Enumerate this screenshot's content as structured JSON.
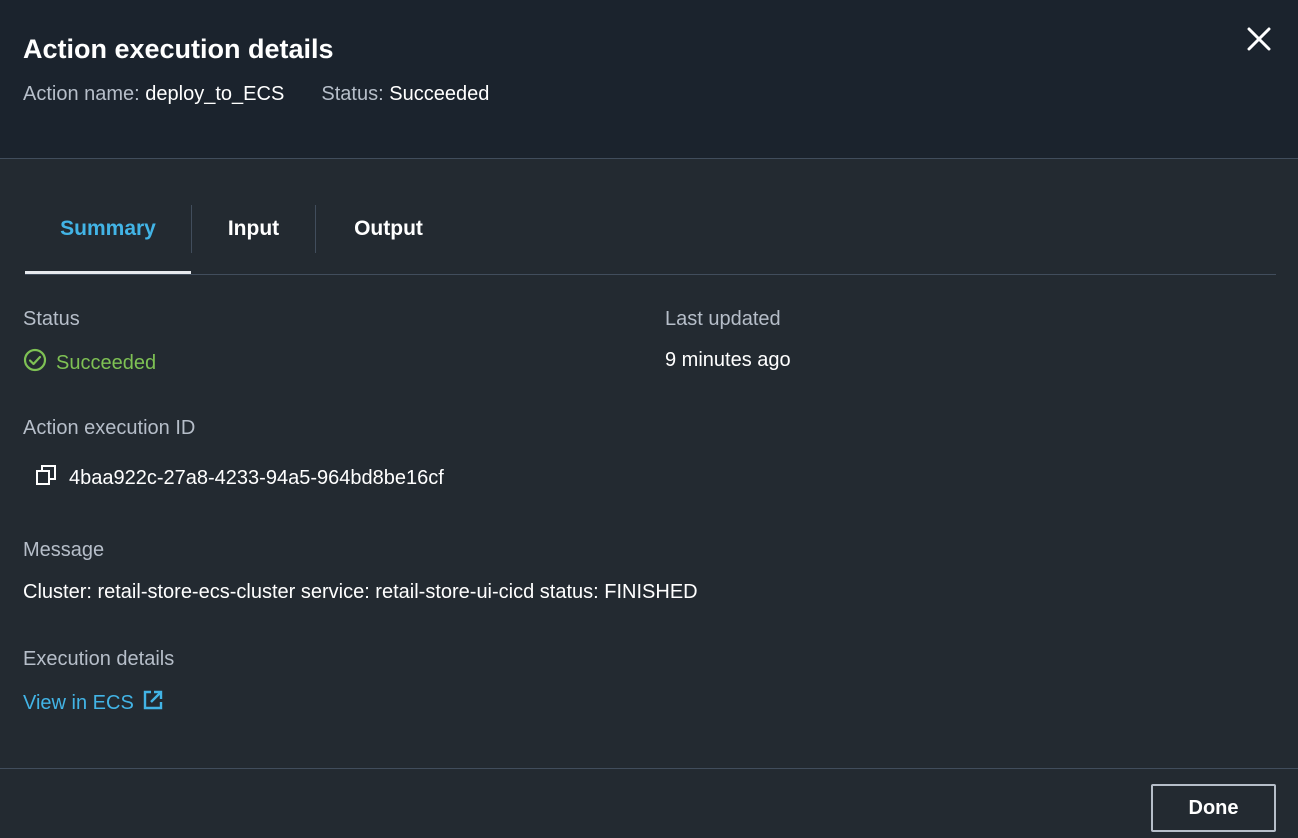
{
  "header": {
    "title": "Action execution details",
    "action_name_label": "Action name:",
    "action_name": "deploy_to_ECS",
    "status_label": "Status:",
    "status": "Succeeded",
    "close_icon": "close-icon"
  },
  "tabs": [
    {
      "label": "Summary",
      "active": true
    },
    {
      "label": "Input",
      "active": false
    },
    {
      "label": "Output",
      "active": false
    }
  ],
  "summary": {
    "status_label": "Status",
    "status_value": "Succeeded",
    "status_icon": "check-circle-icon",
    "last_updated_label": "Last updated",
    "last_updated_value": "9 minutes ago",
    "execution_id_label": "Action execution ID",
    "execution_id_value": "4baa922c-27a8-4233-94a5-964bd8be16cf",
    "copy_icon": "copy-icon",
    "message_label": "Message",
    "message_value": "Cluster: retail-store-ecs-cluster service: retail-store-ui-cicd status: FINISHED",
    "execution_details_label": "Execution details",
    "execution_details_link": "View in ECS",
    "external_link_icon": "external-link-icon"
  },
  "footer": {
    "done_label": "Done"
  },
  "colors": {
    "accent": "#42b4e6",
    "success": "#7ec154",
    "header_bg": "#1b232d",
    "body_bg": "#232a31"
  }
}
